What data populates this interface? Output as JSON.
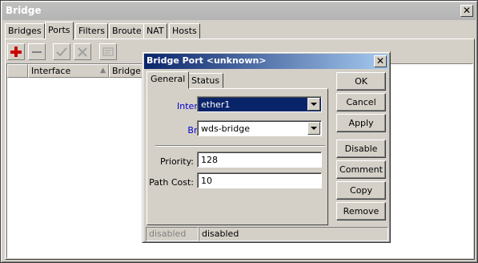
{
  "window": {
    "title": "Bridge"
  },
  "tabs": [
    {
      "label": "Bridges"
    },
    {
      "label": "Ports"
    },
    {
      "label": "Filters"
    },
    {
      "label": "Broute"
    },
    {
      "label": "NAT"
    },
    {
      "label": "Hosts"
    }
  ],
  "toolbar": {
    "add_icon": "plus-icon",
    "remove_icon": "minus-icon",
    "enable_icon": "check-icon",
    "disable_icon": "cross-icon",
    "comment_icon": "comment-icon"
  },
  "list": {
    "columns": [
      {
        "label": "Interface"
      },
      {
        "label": "Bridge"
      }
    ],
    "sort_icon": "sort-triangle-icon"
  },
  "dialog": {
    "title": "Bridge Port <unknown>",
    "tabs": [
      {
        "label": "General"
      },
      {
        "label": "Status"
      }
    ],
    "fields": {
      "interface": {
        "label": "Interface:",
        "value": "ether1"
      },
      "bridge": {
        "label": "Bridge:",
        "value": "wds-bridge"
      },
      "priority": {
        "label": "Priority:",
        "value": "128"
      },
      "path_cost": {
        "label": "Path Cost:",
        "value": "10"
      }
    },
    "buttons": {
      "ok": "OK",
      "cancel": "Cancel",
      "apply": "Apply",
      "disable": "Disable",
      "comment": "Comment",
      "copy": "Copy",
      "remove": "Remove"
    },
    "status_left": "disabled",
    "status_right": "disabled"
  },
  "colors": {
    "dialog_title_active": "#0a246a",
    "window_title_inactive": "#c0c0c0",
    "field_label_blue": "#0000cc",
    "add_icon_red": "#cc0000"
  }
}
